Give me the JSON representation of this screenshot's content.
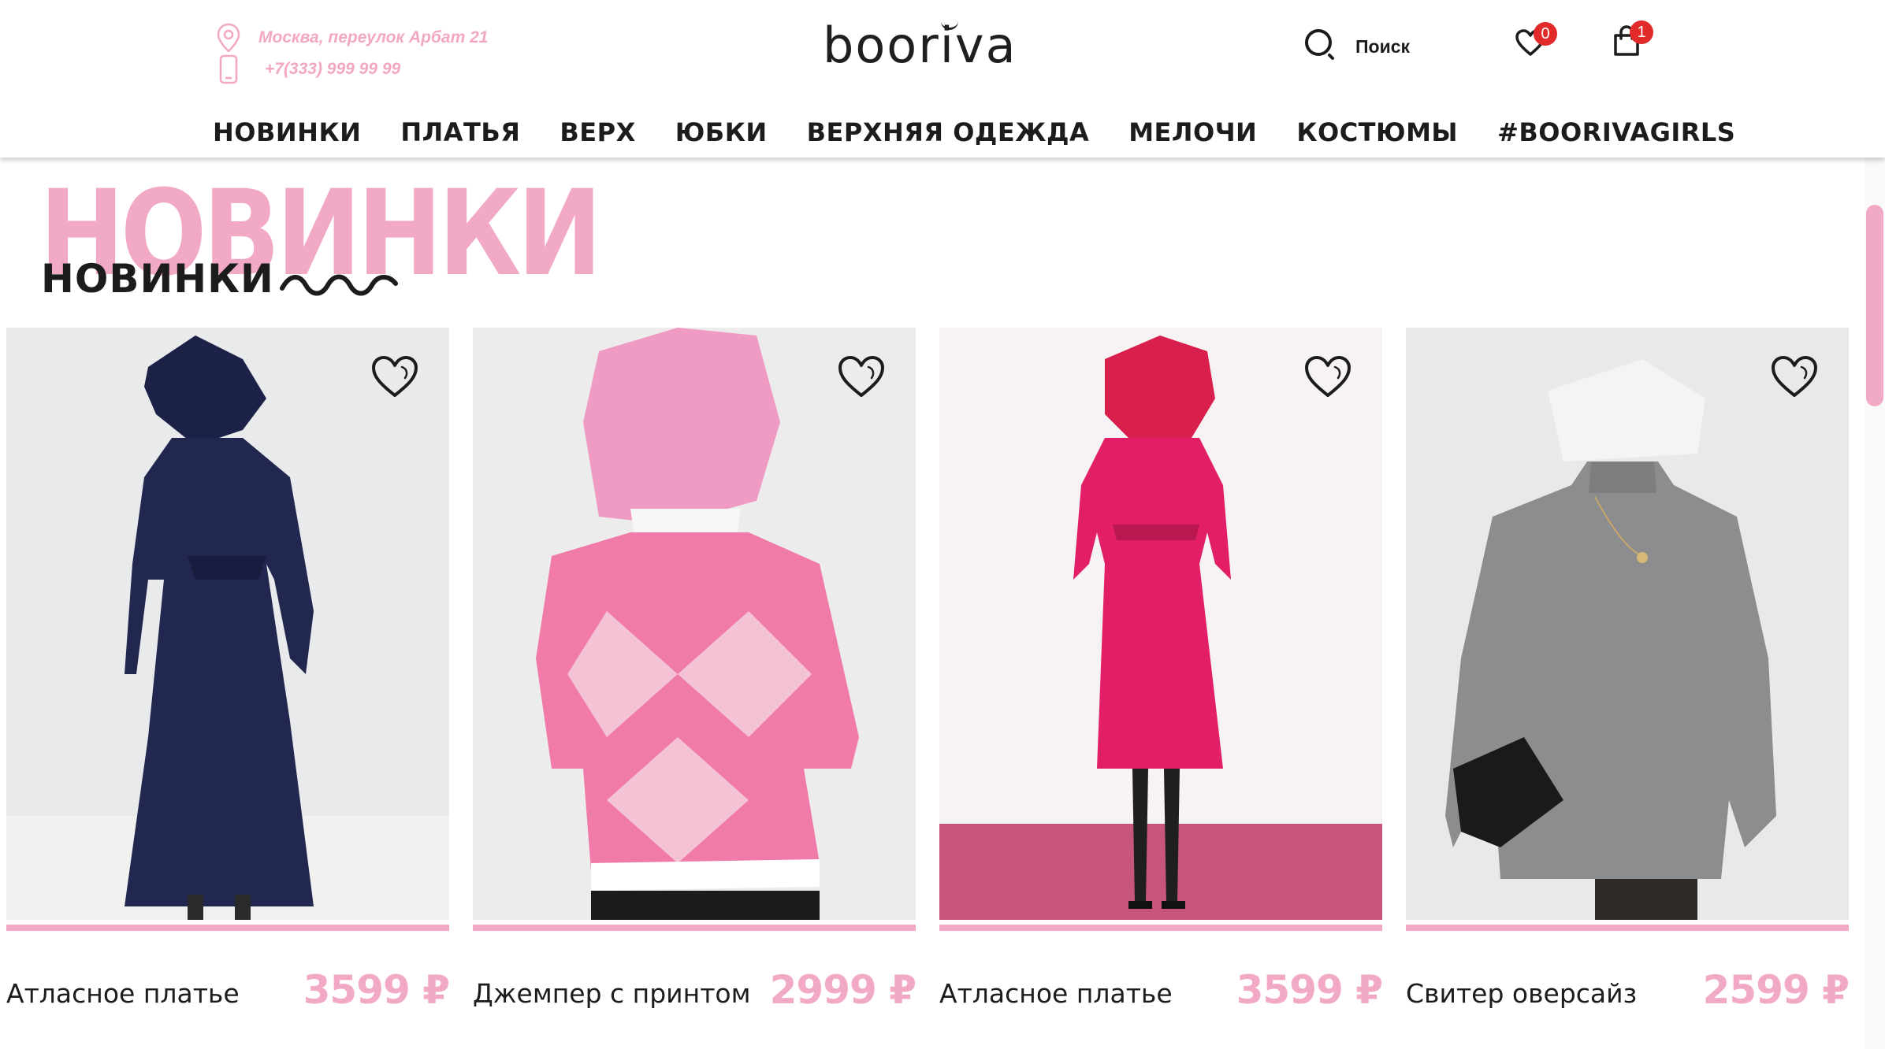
{
  "header": {
    "address": "Москва, переулок Арбат 21",
    "phone": "+7(333) 999 99 99",
    "logo": "booriva",
    "search_label": "Поиск",
    "favorites_count": "0",
    "cart_count": "1"
  },
  "nav": {
    "items": [
      {
        "label": "НОВИНКИ"
      },
      {
        "label": "ПЛАТЬЯ"
      },
      {
        "label": "ВЕРХ"
      },
      {
        "label": "ЮБКИ"
      },
      {
        "label": "ВЕРХНЯЯ ОДЕЖДА"
      },
      {
        "label": "МЕЛОЧИ"
      },
      {
        "label": "КОСТЮМЫ"
      },
      {
        "label": "#BOORIVAGIRLS"
      }
    ]
  },
  "section": {
    "big_title": "НОВИНКИ",
    "title": "НОВИНКИ"
  },
  "products": [
    {
      "name": "Атласное платье",
      "price": "3599 ₽",
      "photo": "navy satin dress"
    },
    {
      "name": "Джемпер с принтом",
      "price": "2999 ₽",
      "photo": "pink argyle jumper"
    },
    {
      "name": "Атласное платье",
      "price": "3599 ₽",
      "photo": "fuchsia satin dress"
    },
    {
      "name": "Свитер оверсайз",
      "price": "2599 ₽",
      "photo": "grey oversized sweater"
    }
  ],
  "colors": {
    "accent_pink": "#f2a9c5",
    "badge_red": "#e12a2a",
    "text_dark": "#1c1c1c"
  },
  "icons": [
    "location-pin-icon",
    "phone-icon",
    "search-icon",
    "heart-icon",
    "shopping-bag-icon",
    "wishlist-heart-icon"
  ]
}
